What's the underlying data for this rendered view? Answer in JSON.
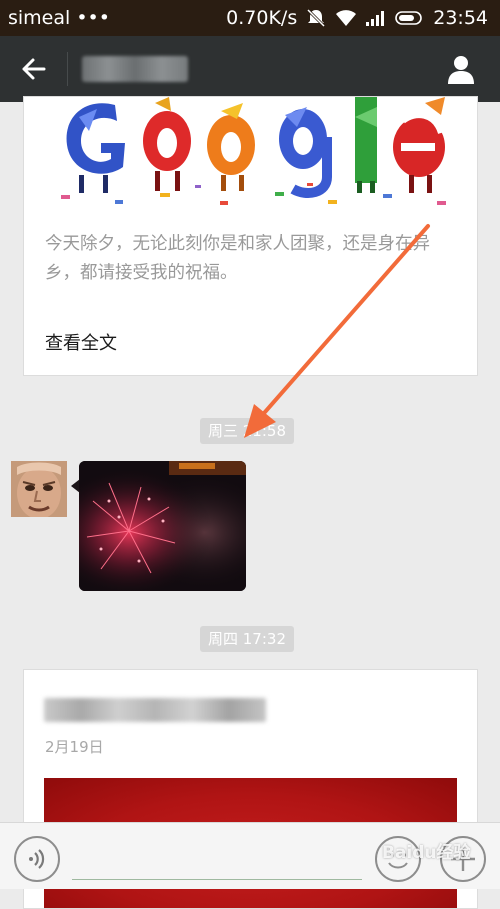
{
  "status_bar": {
    "carrier": "simeal •••",
    "net_speed": "0.70K/s",
    "time": "23:54"
  },
  "header": {
    "back_icon": "arrow-left-icon",
    "profile_icon": "person-icon"
  },
  "article_1": {
    "summary": "今天除夕，无论此刻你是和家人团聚，还是身在异乡，都请接受我的祝福。",
    "read_more": "查看全文"
  },
  "time_badges": [
    "周三 21:58",
    "周四 17:32"
  ],
  "article_2": {
    "date": "2月19日"
  },
  "input_bar": {
    "voice_icon": "voice-wave-icon",
    "emoji_icon": "smiley-icon",
    "plus_icon": "plus-icon"
  },
  "watermark": "Baidu经验",
  "colors": {
    "status_bg": "#2a1d12",
    "header_bg": "#2e3132",
    "chat_bg": "#ebebeb",
    "arrow": "#f26b3a"
  }
}
